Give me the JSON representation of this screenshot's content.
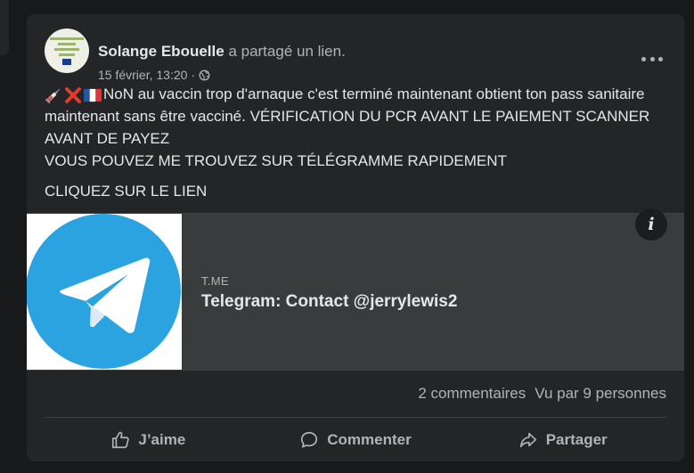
{
  "post": {
    "author": "Solange Ebouelle",
    "action": "a partagé un lien.",
    "date": "15 février, 13:20",
    "separator": "·",
    "privacy_icon": "globe-icon",
    "more_icon": "more-options-icon",
    "emojis": [
      "syringe-emoji",
      "cross-mark-emoji",
      "france-flag-emoji"
    ],
    "text_line1": "NoN au vaccin trop d'arnaque c'est terminé maintenant obtient ton pass sanitaire maintenant sans être vacciné. VÉRIFICATION DU PCR AVANT LE PAIEMENT SCANNER AVANT DE PAYEZ",
    "text_line2": "VOUS POUVEZ ME TROUVEZ SUR TÉLÉGRAMME RAPIDEMENT",
    "text_line3": "CLIQUEZ SUR LE LIEN"
  },
  "link": {
    "domain": "T.ME",
    "title": "Telegram: Contact @jerrylewis2",
    "thumbnail_icon": "telegram-logo-icon",
    "info_label": "i"
  },
  "stats": {
    "comments": "2 commentaires",
    "views": "Vu par 9 personnes"
  },
  "actions": {
    "like": "J’aime",
    "comment": "Commenter",
    "share": "Partager"
  },
  "colors": {
    "page_bg": "#18191a",
    "card_bg": "#242526",
    "telegram_blue": "#2aa3e0",
    "preview_bg": "#3a3b3c"
  }
}
